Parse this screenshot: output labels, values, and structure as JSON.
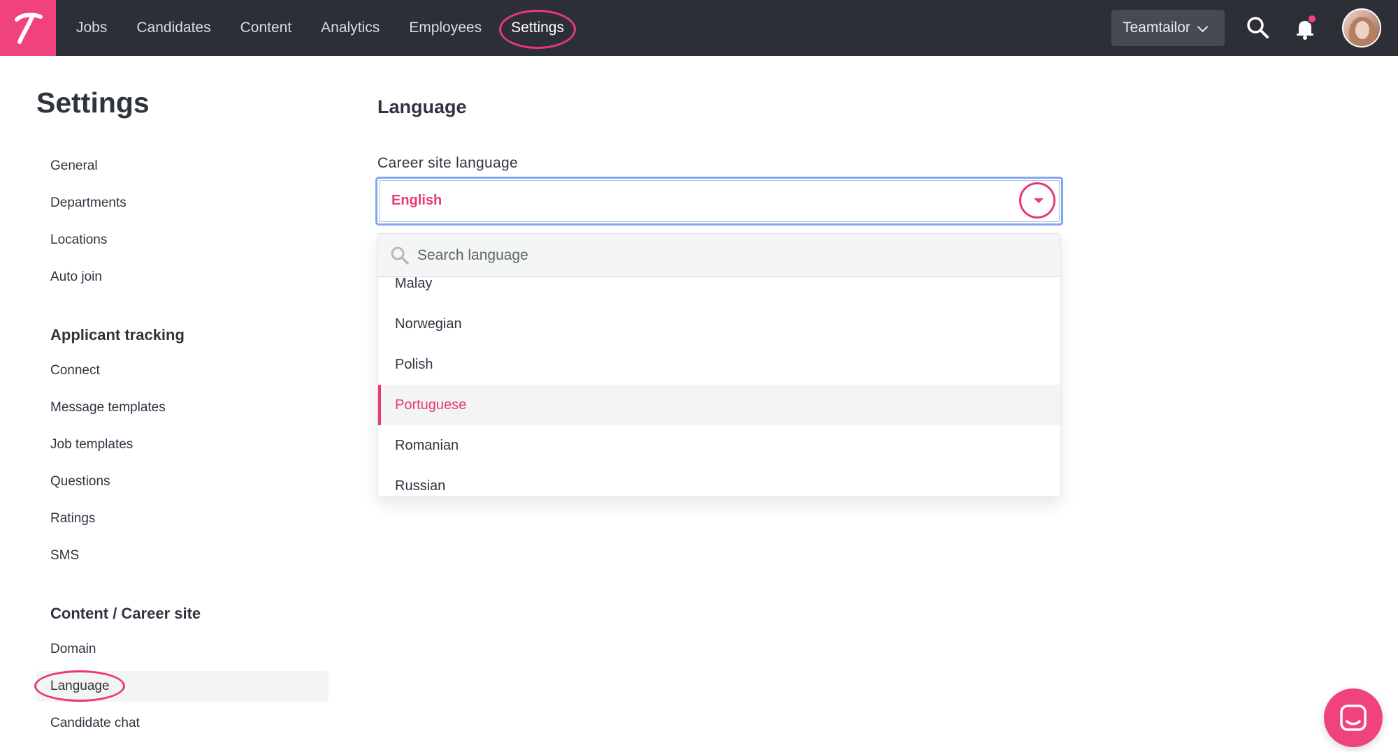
{
  "topbar": {
    "logo": "T",
    "nav": [
      "Jobs",
      "Candidates",
      "Content",
      "Analytics",
      "Employees",
      "Settings"
    ],
    "active_nav": "Settings",
    "company": "Teamtailor",
    "icons": [
      "search-icon",
      "bell-icon",
      "avatar"
    ],
    "notification_dot_color": "#f0427f"
  },
  "sidebar": {
    "title": "Settings",
    "groups": [
      {
        "heading": "",
        "items": [
          "General",
          "Departments",
          "Locations",
          "Auto join"
        ]
      },
      {
        "heading": "Applicant tracking",
        "items": [
          "Connect",
          "Message templates",
          "Job templates",
          "Questions",
          "Ratings",
          "SMS"
        ]
      },
      {
        "heading": "Content / Career site",
        "items": [
          "Domain",
          "Language",
          "Candidate chat"
        ]
      }
    ],
    "active_item": "Language"
  },
  "main": {
    "title": "Language",
    "field_label": "Career site language",
    "selected_value": "English",
    "dropdown": {
      "search_placeholder": "Search language",
      "options": [
        "Malay",
        "Norwegian",
        "Polish",
        "Portuguese",
        "Romanian",
        "Russian"
      ],
      "highlighted": "Portuguese"
    }
  },
  "colors": {
    "accent": "#e8387a",
    "brand_pink": "#f0427f",
    "nav_bg": "#2d2f37",
    "focus_border": "#7fa7f0"
  }
}
